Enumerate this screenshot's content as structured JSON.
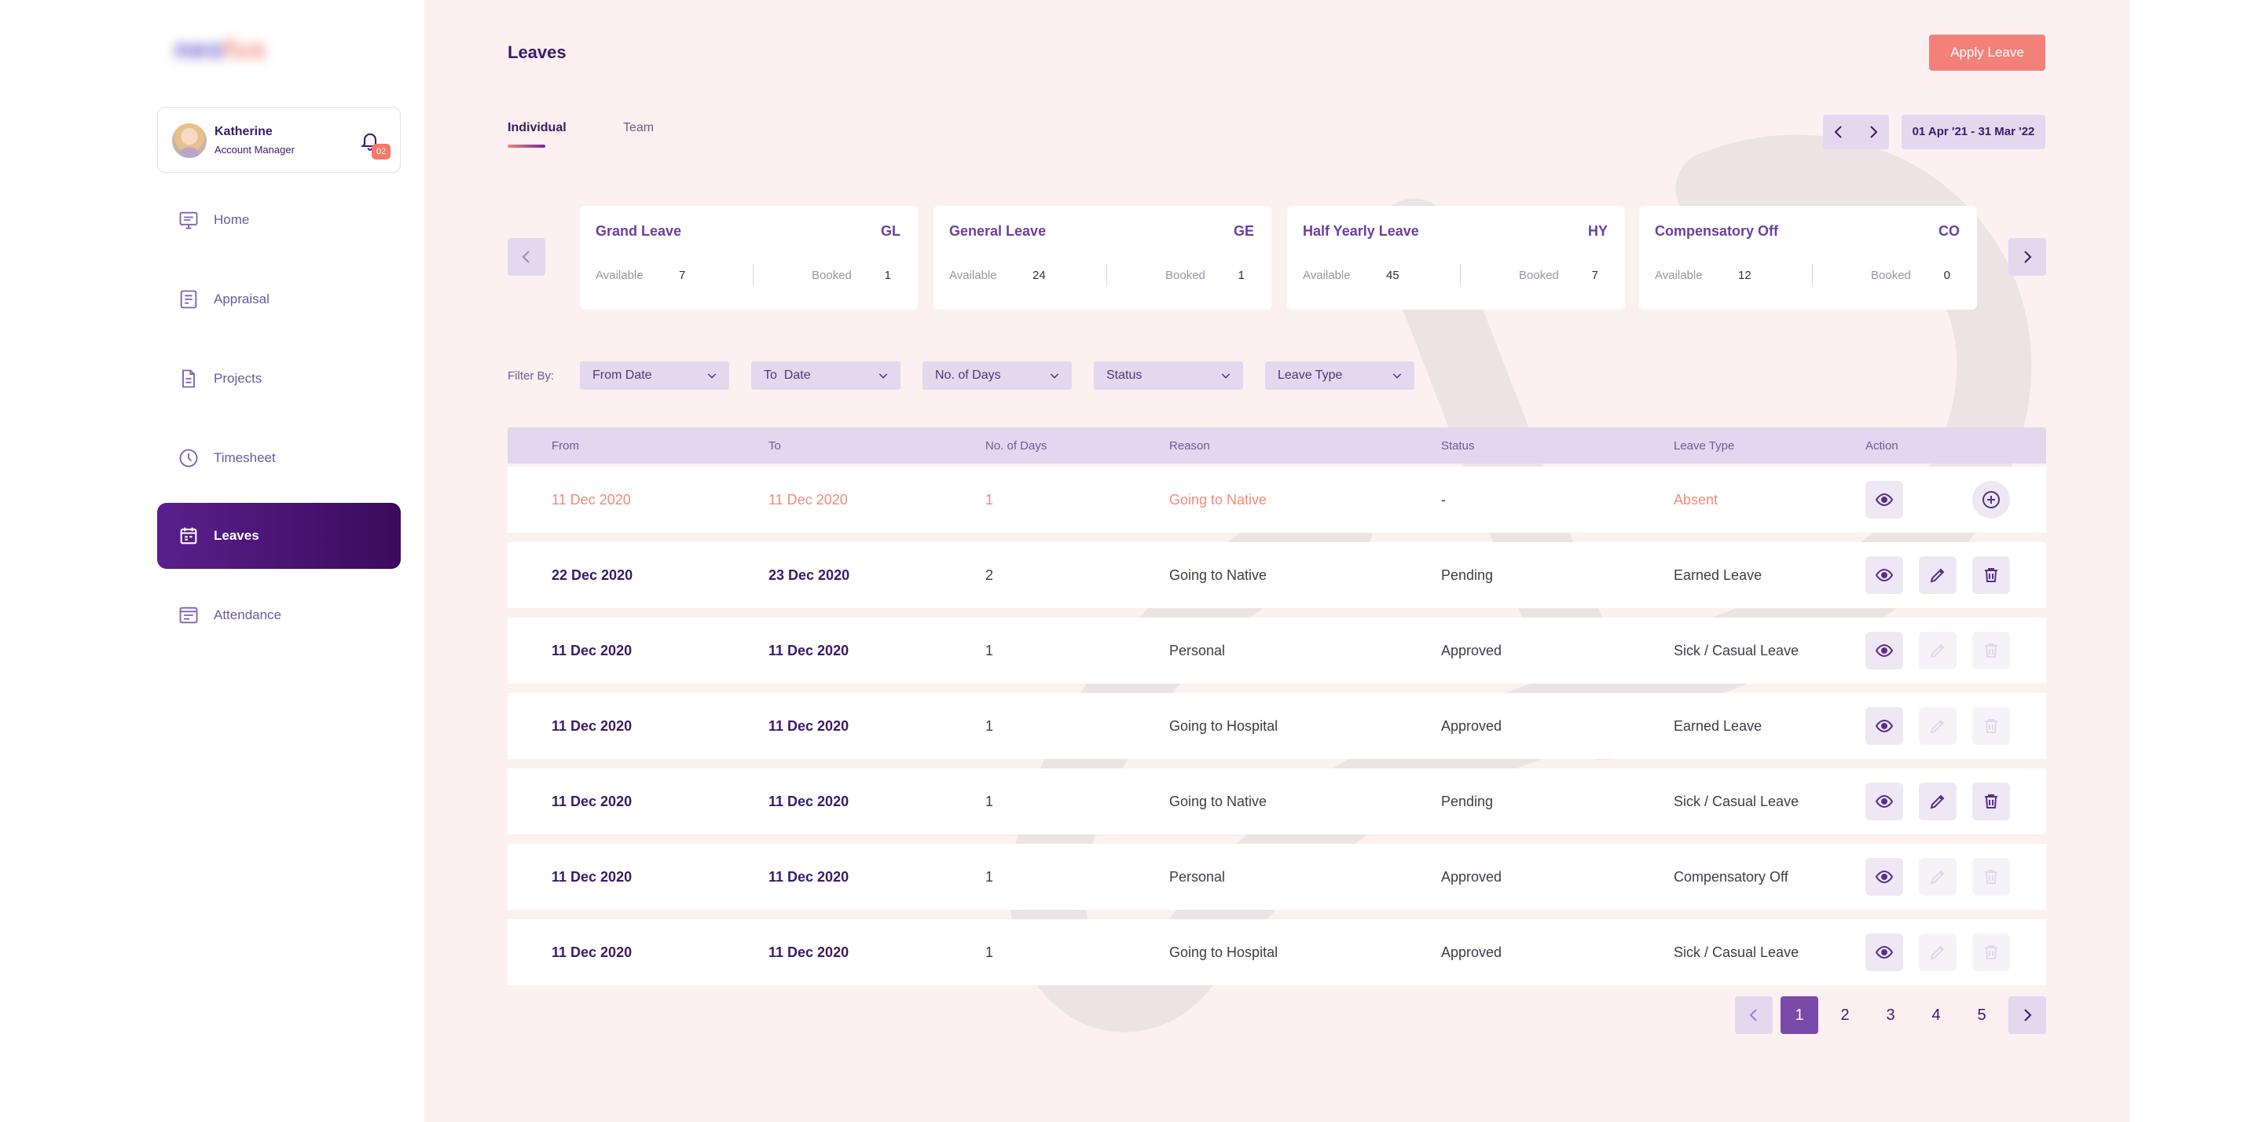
{
  "app": {
    "logo": {
      "part1": "neo",
      "part2": "fus"
    }
  },
  "profile": {
    "name": "Katherine",
    "role": "Account Manager",
    "notification_count": "02"
  },
  "sidebar": {
    "items": [
      {
        "label": "Home",
        "icon": "monitor-icon",
        "active": false
      },
      {
        "label": "Appraisal",
        "icon": "appraisal-icon",
        "active": false
      },
      {
        "label": "Projects",
        "icon": "document-icon",
        "active": false
      },
      {
        "label": "Timesheet",
        "icon": "clock-icon",
        "active": false
      },
      {
        "label": "Leaves",
        "icon": "calendar-icon",
        "active": true
      },
      {
        "label": "Attendance",
        "icon": "attendance-icon",
        "active": false
      }
    ]
  },
  "header": {
    "title": "Leaves",
    "apply_button": "Apply Leave",
    "tabs": [
      "Individual",
      "Team"
    ],
    "active_tab": "Individual",
    "date_range": "01 Apr '21 - 31 Mar '22"
  },
  "leave_cards": [
    {
      "title": "Grand Leave",
      "code": "GL",
      "available_label": "Available",
      "available": "7",
      "booked_label": "Booked",
      "booked": "1"
    },
    {
      "title": "General Leave",
      "code": "GE",
      "available_label": "Available",
      "available": "24",
      "booked_label": "Booked",
      "booked": "1"
    },
    {
      "title": "Half Yearly Leave",
      "code": "HY",
      "available_label": "Available",
      "available": "45",
      "booked_label": "Booked",
      "booked": "7"
    },
    {
      "title": "Compensatory Off",
      "code": "CO",
      "available_label": "Available",
      "available": "12",
      "booked_label": "Booked",
      "booked": "0"
    }
  ],
  "filters": {
    "label": "Filter By:",
    "items": [
      "From Date",
      "To  Date",
      "No. of Days",
      "Status",
      "Leave Type"
    ]
  },
  "table": {
    "columns": [
      "From",
      "To",
      "No. of Days",
      "Reason",
      "Status",
      "Leave Type",
      "Action"
    ],
    "rows": [
      {
        "from": "11 Dec 2020",
        "to": "11 Dec 2020",
        "days": "1",
        "reason": "Going to Native",
        "status": "-",
        "type": "Absent",
        "actions": "view-add"
      },
      {
        "from": "22 Dec 2020",
        "to": "23 Dec 2020",
        "days": "2",
        "reason": "Going to Native",
        "status": "Pending",
        "type": "Earned Leave",
        "actions": "view-edit-delete"
      },
      {
        "from": "11 Dec 2020",
        "to": "11 Dec 2020",
        "days": "1",
        "reason": "Personal",
        "status": "Approved",
        "type": "Sick / Casual Leave",
        "actions": "view-disabled"
      },
      {
        "from": "11 Dec 2020",
        "to": "11 Dec 2020",
        "days": "1",
        "reason": "Going to Hospital",
        "status": "Approved",
        "type": "Earned Leave",
        "actions": "view-disabled"
      },
      {
        "from": "11 Dec 2020",
        "to": "11 Dec 2020",
        "days": "1",
        "reason": "Going to Native",
        "status": "Pending",
        "type": "Sick / Casual Leave",
        "actions": "view-edit-delete"
      },
      {
        "from": "11 Dec 2020",
        "to": "11 Dec 2020",
        "days": "1",
        "reason": "Personal",
        "status": "Approved",
        "type": "Compensatory Off",
        "actions": "view-disabled"
      },
      {
        "from": "11 Dec 2020",
        "to": "11 Dec 2020",
        "days": "1",
        "reason": "Going to Hospital",
        "status": "Approved",
        "type": "Sick / Casual Leave",
        "actions": "view-disabled"
      }
    ]
  },
  "pagination": {
    "pages": [
      "1",
      "2",
      "3",
      "4",
      "5"
    ],
    "current": "1"
  },
  "colors": {
    "brand_purple": "#3b1a6b",
    "accent_coral": "#f4807a",
    "active_nav": "#5a1f8c",
    "page_background": "#fcf0f1",
    "header_bg": "#e3d6ef"
  }
}
